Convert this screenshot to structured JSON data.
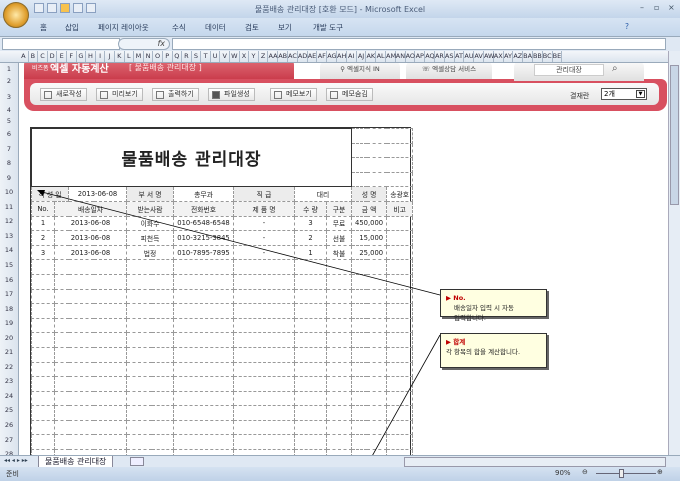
{
  "window": {
    "title": "물품배송 관리대장  [호환 모드] - Microsoft Excel"
  },
  "ribbon": {
    "tabs": [
      "홈",
      "삽입",
      "페이지 레이아웃",
      "수식",
      "데이터",
      "검토",
      "보기",
      "개발 도구"
    ]
  },
  "formula": {
    "fx": "fx",
    "value": ""
  },
  "columns": [
    "A",
    "B",
    "C",
    "D",
    "E",
    "F",
    "G",
    "H",
    "I",
    "J",
    "K",
    "L",
    "M",
    "N",
    "O",
    "P",
    "Q",
    "R",
    "S",
    "T",
    "U",
    "V",
    "W",
    "X",
    "Y",
    "Z",
    "AA",
    "AB",
    "AC",
    "AD",
    "AE",
    "AF",
    "AG",
    "AH",
    "AI",
    "AJ",
    "AK",
    "AL",
    "AM",
    "AN",
    "AO",
    "AP",
    "AQ",
    "AR",
    "AS",
    "AT",
    "AU",
    "AV",
    "AW",
    "AX",
    "AY",
    "AZ",
    "BA",
    "BB",
    "BC",
    "BE"
  ],
  "banner": {
    "brand_small": "비즈폼",
    "brand": "엑셀 자동계산",
    "doc": "[ 물품배송 관리대장 ]",
    "tab1": "엑셀지식 IN",
    "tab2": "엑셀상담 서비스",
    "search_value": "관리대장",
    "buttons": [
      "새로작성",
      "미리보기",
      "출력하기",
      "파일생성",
      "메모보기",
      "메모숨김"
    ],
    "approval_label": "결재란",
    "approval_value": "2개"
  },
  "sheet": {
    "title": "물품배송 관리대장",
    "info": {
      "date_label": "작 성 일",
      "date": "2013-06-08",
      "dept_label": "부 서 명",
      "dept": "총무과",
      "rank_label": "직  급",
      "rank": "대리",
      "name_label": "성  명",
      "name": "송광호"
    },
    "headers": [
      "No.",
      "배송일자",
      "받는사람",
      "전화번호",
      "제 품 명",
      "수 량",
      "구분",
      "금  액",
      "비고"
    ],
    "rows": [
      [
        "1",
        "2013-06-08",
        "이화수",
        "010-6548-6548",
        "-",
        "3",
        "무료",
        "450,000",
        ""
      ],
      [
        "2",
        "2013-06-08",
        "피천득",
        "010-3215-3845",
        "-",
        "2",
        "선불",
        "15,000",
        ""
      ],
      [
        "3",
        "2013-06-08",
        "법정",
        "010-7895-7895",
        "-",
        "1",
        "착불",
        "25,000",
        ""
      ]
    ]
  },
  "comments": [
    {
      "title": "No.",
      "body": "배송일자 입력 시 자동입력합니다."
    },
    {
      "title": "합계",
      "body": "각 항목의 합을 계산합니다."
    }
  ],
  "sheet_tab": "물품배송 관리대장",
  "status": {
    "ready": "준비",
    "zoom": "90%"
  }
}
